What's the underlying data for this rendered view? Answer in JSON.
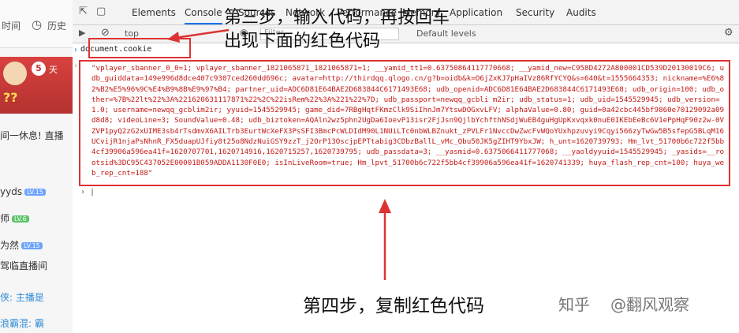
{
  "sidebar": {
    "toolbar": {
      "refresh_label": "时间",
      "history_label": "历史"
    },
    "banner": {
      "count": "5",
      "day": "天"
    },
    "items": [
      {
        "text": "间一休息! 直播"
      },
      {
        "text": "yyds",
        "badge": "LV.15"
      },
      {
        "text": "师",
        "badge": "LV.6"
      },
      {
        "text": "为然",
        "badge": "LV.15"
      },
      {
        "text": "驾临直播间"
      },
      {
        "text": "侠: 主播是"
      },
      {
        "text": "浪霸混: 霸"
      }
    ]
  },
  "devtools": {
    "tabs": [
      "Elements",
      "Console",
      "Sources",
      "Network",
      "Performance",
      "Memory",
      "Application",
      "Security",
      "Audits"
    ],
    "console_toolbar": {
      "context": "top",
      "filter_placeholder": "Filter",
      "levels": "Default levels"
    },
    "command": "document.cookie",
    "output": "\"vplayer_sbanner_0_0=1; vplayer_sbanner_1821065871_1821065871=1; __yamid_tt1=0.63750864117770668; __yamid_new=C958D4272A800001CD539D20130019C6; udb_guiddata=149e996d8dce407c9307ced260dd696c; avatar=http://thirdqq.qlogo.cn/g?b=oidb&k=O6jZxKJ7pHaIVz86RfYCYQ&s=640&t=1555664353; nickname=%E6%82%B2%E5%96%9C%E4%B9%8B%E9%97%B4; partner_uid=ADC6D81E64BAE2D683844C6171493E68; udb_openid=ADC6D81E64BAE2D683844C6171493E68; udb_origin=100; udb_other=%7B%22lt%22%3A%221620631117871%22%2C%22isRem%22%3A%221%22%7D; udb_passport=newqq_gcbli m2ir; udb_status=1; udb_uid=1545529945; udb_version=1.0; username=newqq_gcblim2ir; yyuid=1545529945; game_did=7RBgHqtFKmzClk9SiIhnJm7YtswDOGxvLFV; alphaValue=0.80; guid=0a42cbc445bf9860e70129092a09d8d8; videoLine=3; SoundValue=0.48; udb_biztoken=AQAln2wz5phn2UgDa6IoevP13isr2FjJsn9QjlbYchfthNSdjWuEB4guHgUpKxvqxk0nuE0IKEbEeBc6V1ePpHqF90z2w-0VZVP1pyQ2zG2xUIME3sb4rTsdmvX6AILTrb3EurtWcXeFX3PsSFI3BmcPcWLDIdM90L1NUiLTc0nbWLBZnukt_zPVLFr1NvccDwZwcFvWQoYUxhpzuvyi9Cqyi566zyTwGw5B5sfepG5BLqM16UCvijR1njaPsNhnR_FX5duapUJfiy8t25o8NdzNuiGSY9zzT_j2OrP13OscjpEPTtabig3CDbzBallL_vMc_Qbu50JK5gZIHT9YbxJW; h_unt=1620739793; Hm_lvt_51700b6c722f5bb4cf39906a596ea41f=1620707701,1620714916,1620715257,1620739795; udb_passdata=3; __yasmid=0.6375066411777068; __yaoldyyuid=1545529945; _yasids=__rootsid%3DC95C437052E00001B059ADDA1130F0E0; isInLiveRoom=true; Hm_lpvt_51700b6c722f5bb4cf39906a596ea41f=1620741339; huya_flash_rep_cnt=100; huya_web_rep_cnt=188\""
  },
  "annotations": {
    "step3_line1": "第三步，输入代码，再按回车",
    "step3_line2": "出现下面的红色代码",
    "step4": "第四步，复制红色代码"
  },
  "watermark": {
    "platform": "知乎",
    "author": "@翻风观察"
  },
  "colors": {
    "accent_red": "#dd3333",
    "output_text": "#c41a16"
  }
}
